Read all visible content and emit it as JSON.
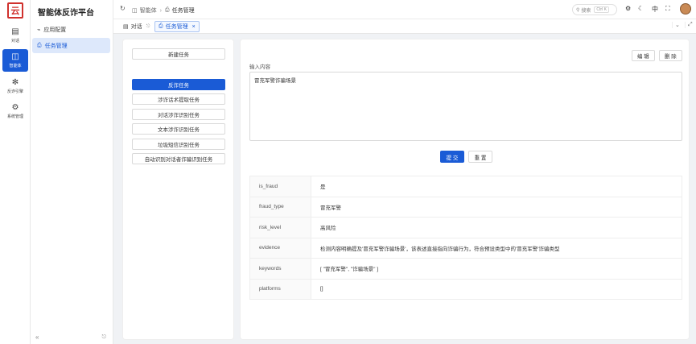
{
  "app": {
    "logo_text": "云",
    "title": "智能体反诈平台"
  },
  "rail": [
    {
      "label": "对话",
      "icon": "chat-icon"
    },
    {
      "label": "智能体",
      "icon": "agent-icon"
    },
    {
      "label": "反诈引擎",
      "icon": "engine-icon"
    },
    {
      "label": "系统管理",
      "icon": "settings-icon"
    }
  ],
  "sidebar": {
    "items": [
      {
        "label": "应用配置",
        "icon": "app-config-icon"
      },
      {
        "label": "任务管理",
        "icon": "task-icon"
      }
    ]
  },
  "header": {
    "breadcrumb": [
      "智能体",
      "任务管理"
    ],
    "search_placeholder": "搜索",
    "search_shortcut": "Ctrl K"
  },
  "tabs": [
    {
      "label": "对话",
      "active": false
    },
    {
      "label": "任务管理",
      "active": true
    }
  ],
  "left_panel": {
    "new_task_label": "新建任务",
    "tasks": [
      "反诈任务",
      "涉诈话术提取任务",
      "对话涉诈识别任务",
      "文本涉诈识别任务",
      "垃圾短信识别任务",
      "自动识别对话者诈骗识别任务"
    ],
    "active_task": "反诈任务"
  },
  "editor": {
    "edit_label": "编 辑",
    "delete_label": "删 除",
    "input_label": "输入内容",
    "input_value": "冒充军警诈骗场景",
    "submit_label": "提 交",
    "reset_label": "重 置"
  },
  "result": [
    {
      "key": "is_fraud",
      "value": "是"
    },
    {
      "key": "fraud_type",
      "value": "冒充军警"
    },
    {
      "key": "risk_level",
      "value": "高风险"
    },
    {
      "key": "evidence",
      "value": "检测内容明确提及'冒充军警诈骗场景'，该表述直接指向诈骗行为，符合预设类型中的'冒充军警'诈骗类型"
    },
    {
      "key": "keywords",
      "value": "[ \"冒充军警\", \"诈骗场景\" ]"
    },
    {
      "key": "platforms",
      "value": "[]"
    }
  ],
  "colors": {
    "primary": "#1a5bd6",
    "logo": "#d0312d",
    "background": "#f0f2f5"
  }
}
